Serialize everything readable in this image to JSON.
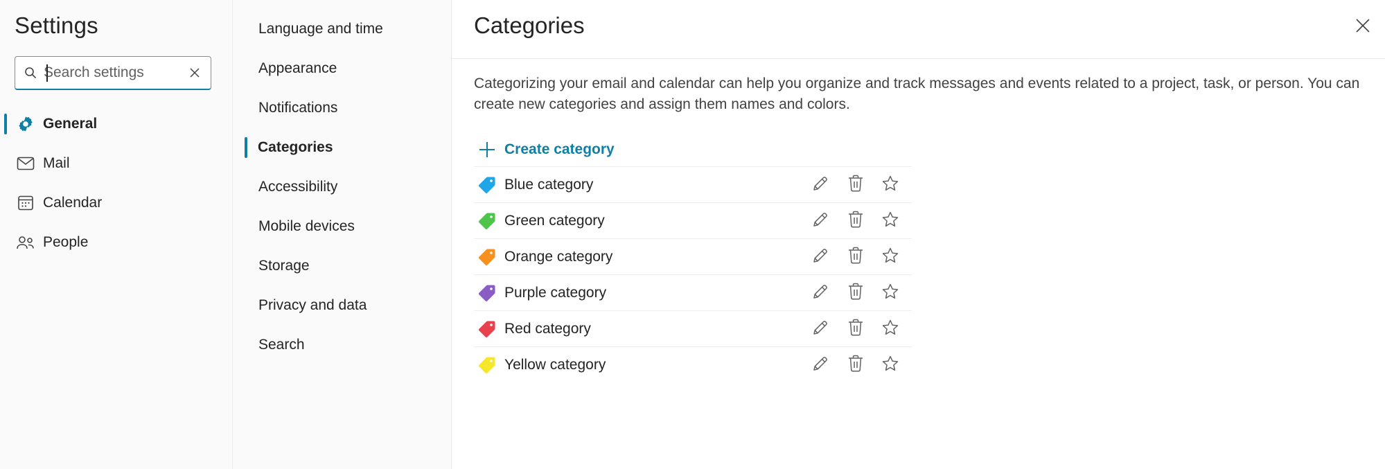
{
  "nav": {
    "title": "Settings",
    "search": {
      "placeholder": "Search settings",
      "value": ""
    },
    "items": [
      {
        "label": "General",
        "icon": "gear-icon",
        "active": true
      },
      {
        "label": "Mail",
        "icon": "mail-icon",
        "active": false
      },
      {
        "label": "Calendar",
        "icon": "calendar-icon",
        "active": false
      },
      {
        "label": "People",
        "icon": "people-icon",
        "active": false
      }
    ]
  },
  "subnav": {
    "items": [
      {
        "label": "Language and time",
        "active": false
      },
      {
        "label": "Appearance",
        "active": false
      },
      {
        "label": "Notifications",
        "active": false
      },
      {
        "label": "Categories",
        "active": true
      },
      {
        "label": "Accessibility",
        "active": false
      },
      {
        "label": "Mobile devices",
        "active": false
      },
      {
        "label": "Storage",
        "active": false
      },
      {
        "label": "Privacy and data",
        "active": false
      },
      {
        "label": "Search",
        "active": false
      }
    ]
  },
  "main": {
    "title": "Categories",
    "description": "Categorizing your email and calendar can help you organize and track messages and events related to a project, task, or person. You can create new categories and assign them names and colors.",
    "create_label": "Create category",
    "categories": [
      {
        "name": "Blue category",
        "color": "#1fa6e8"
      },
      {
        "name": "Green category",
        "color": "#4fc44a"
      },
      {
        "name": "Orange category",
        "color": "#f7901e"
      },
      {
        "name": "Purple category",
        "color": "#8a5cc4"
      },
      {
        "name": "Red category",
        "color": "#e8424f"
      },
      {
        "name": "Yellow category",
        "color": "#f5e82a"
      }
    ]
  },
  "colors": {
    "accent": "#0f7fa6",
    "icon_gray": "#616161"
  }
}
